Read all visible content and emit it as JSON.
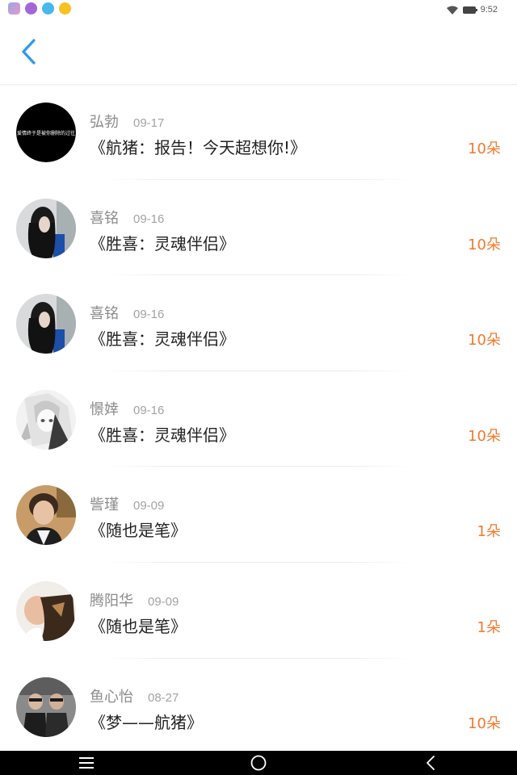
{
  "status": {
    "time": "9:52",
    "app_icons": [
      "anime-app-icon",
      "settings-flower-icon",
      "blue-chat-icon",
      "yellow-star-icon"
    ]
  },
  "header": {
    "back_icon": "chevron-left-icon"
  },
  "colors": {
    "accent_blue": "#2a9af0",
    "count_orange": "#f07a2e"
  },
  "items": [
    {
      "name": "弘勃",
      "date": "09-17",
      "title": "《航猪：报告！今天超想你!》",
      "count": "10朵",
      "avatar": "black-circle-avatar",
      "avatar_text": "爱情终于是被你删除的过往"
    },
    {
      "name": "喜铭",
      "date": "09-16",
      "title": "《胜喜：灵魂伴侣》",
      "count": "10朵",
      "avatar": "long-hair-girl-avatar"
    },
    {
      "name": "喜铭",
      "date": "09-16",
      "title": "《胜喜：灵魂伴侣》",
      "count": "10朵",
      "avatar": "long-hair-girl-avatar"
    },
    {
      "name": "憬婞",
      "date": "09-16",
      "title": "《胜喜：灵魂伴侣》",
      "count": "10朵",
      "avatar": "anime-sketch-avatar"
    },
    {
      "name": "訾瑾",
      "date": "09-09",
      "title": "《随也是笔》",
      "count": "1朵",
      "avatar": "boy-portrait-avatar"
    },
    {
      "name": "腾阳华",
      "date": "09-09",
      "title": "《随也是笔》",
      "count": "1朵",
      "avatar": "baby-dog-avatar"
    },
    {
      "name": "鱼心怡",
      "date": "08-27",
      "title": "《梦——航猪》",
      "count": "10朵",
      "avatar": "couple-photo-avatar"
    }
  ],
  "nav": [
    "menu-icon",
    "home-circle-icon",
    "back-triangle-icon"
  ]
}
